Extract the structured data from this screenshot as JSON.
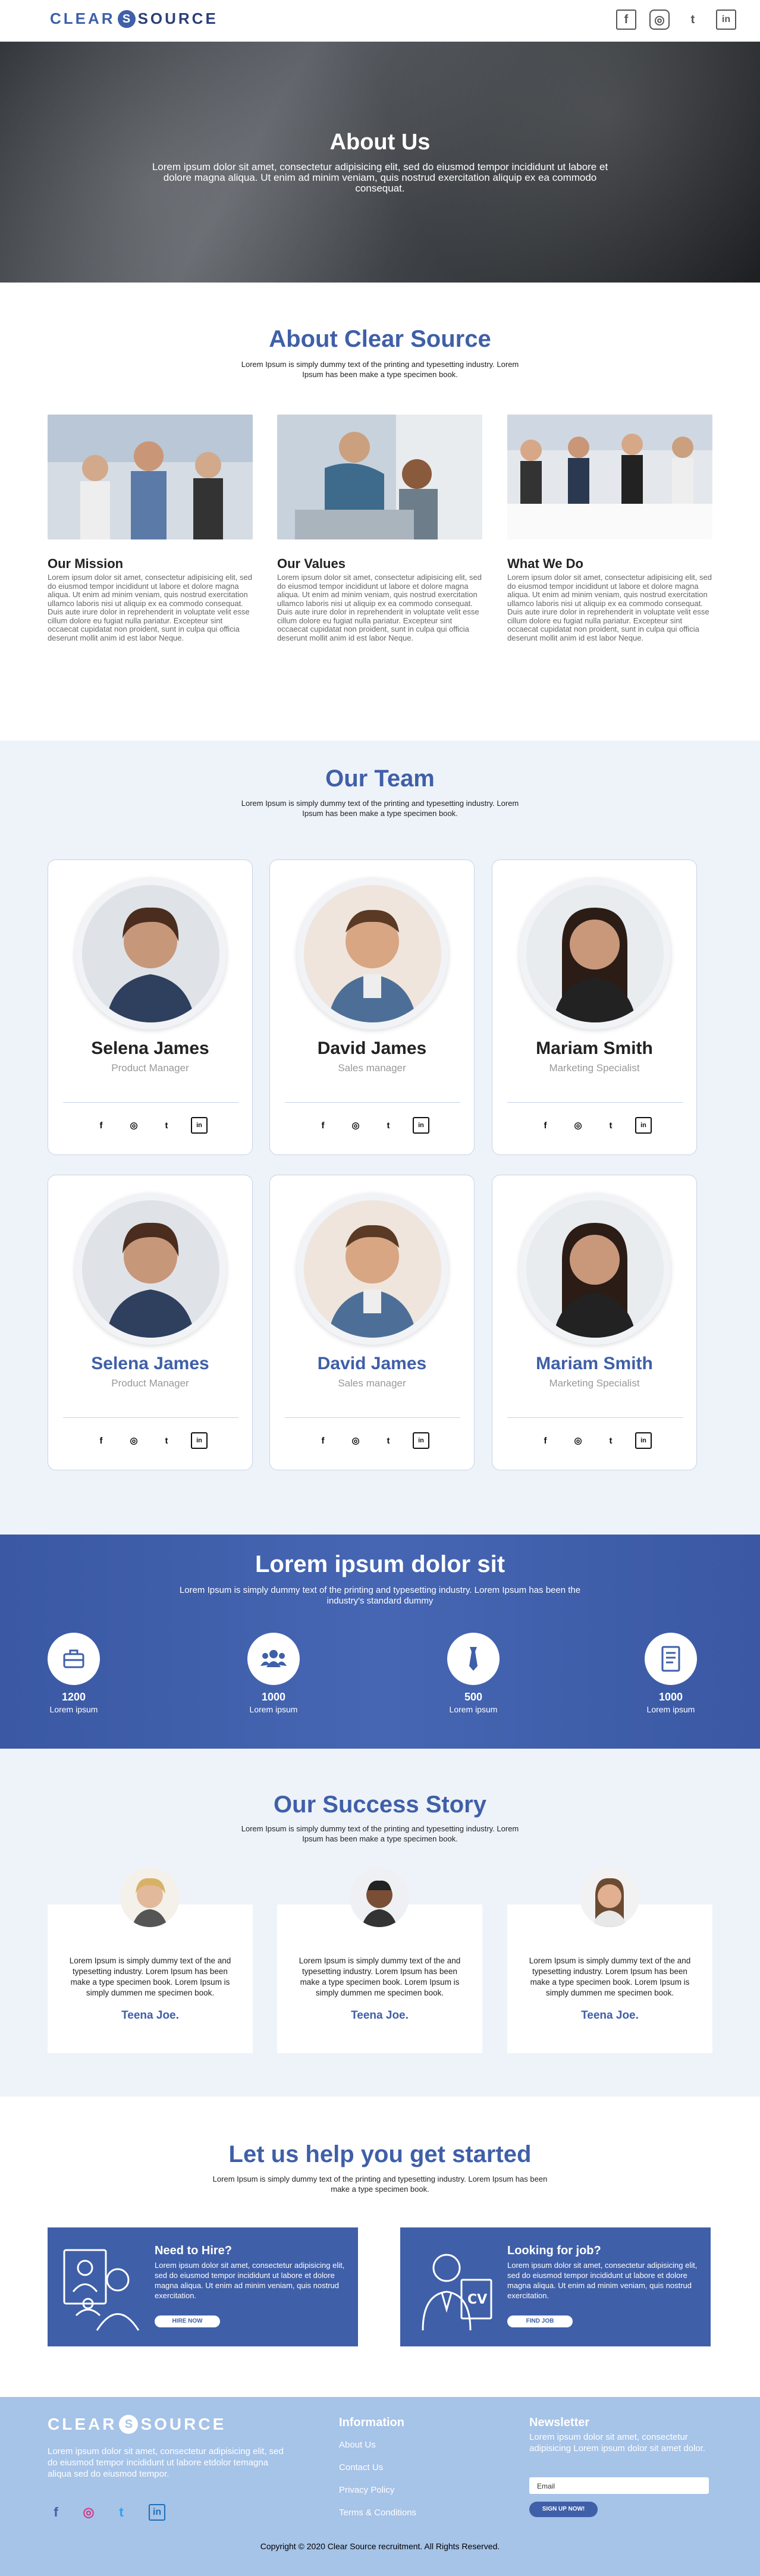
{
  "brand": {
    "logo_left": "CLEAR",
    "logo_right": "SOURCE",
    "logo_s": "S",
    "color": "#3f5fa8"
  },
  "header": {
    "social": [
      "f",
      "◎",
      "t",
      "in"
    ]
  },
  "hero": {
    "title": "About Us",
    "text": "Lorem ipsum dolor sit amet, consectetur adipisicing elit, sed do eiusmod tempor incididunt ut labore et dolore magna aliqua. Ut enim ad minim veniam, quis nostrud exercitation aliquip ex ea commodo consequat."
  },
  "about": {
    "title": "About Clear Source",
    "subtitle": "Lorem Ipsum is simply dummy text of the printing and typesetting industry. Lorem Ipsum has been make a type specimen book.",
    "items": [
      {
        "heading": "Our Mission",
        "text": "Lorem ipsum dolor sit amet, consectetur adipisicing elit, sed do eiusmod tempor incididunt ut labore et dolore magna aliqua. Ut enim ad minim veniam, quis nostrud exercitation ullamco laboris nisi ut aliquip ex ea commodo consequat. Duis aute irure dolor in reprehenderit in voluptate velit esse cillum dolore eu fugiat nulla pariatur. Excepteur sint occaecat cupidatat non proident, sunt in culpa qui officia deserunt mollit anim id est labor Neque."
      },
      {
        "heading": "Our Values",
        "text": "Lorem ipsum dolor sit amet, consectetur adipisicing elit, sed do eiusmod tempor incididunt ut labore et dolore magna aliqua. Ut enim ad minim veniam, quis nostrud exercitation ullamco laboris nisi ut aliquip ex ea commodo consequat. Duis aute irure dolor in reprehenderit in voluptate velit esse cillum dolore eu fugiat nulla pariatur. Excepteur sint occaecat cupidatat non proident, sunt in culpa qui officia deserunt mollit anim id est labor Neque."
      },
      {
        "heading": "What We Do",
        "text": "Lorem ipsum dolor sit amet, consectetur adipisicing elit, sed do eiusmod tempor incididunt ut labore et dolore magna aliqua. Ut enim ad minim veniam, quis nostrud exercitation ullamco laboris nisi ut aliquip ex ea commodo consequat. Duis aute irure dolor in reprehenderit in voluptate velit esse cillum dolore eu fugiat nulla pariatur. Excepteur sint occaecat cupidatat non proident, sunt in culpa qui officia deserunt mollit anim id est labor Neque."
      }
    ]
  },
  "team": {
    "title": "Our Team",
    "subtitle": "Lorem Ipsum is simply dummy text of the printing and typesetting industry. Lorem Ipsum has been make a type specimen book.",
    "members": [
      {
        "name": "Selena James",
        "role": "Product Manager"
      },
      {
        "name": "David James",
        "role": "Sales manager"
      },
      {
        "name": "Mariam Smith",
        "role": "Marketing Specialist"
      },
      {
        "name": "Selena James",
        "role": "Product Manager"
      },
      {
        "name": "David James",
        "role": "Sales manager"
      },
      {
        "name": "Mariam Smith",
        "role": "Marketing Specialist"
      }
    ],
    "social": [
      "f",
      "◎",
      "t",
      "in"
    ]
  },
  "stats": {
    "title": "Lorem ipsum dolor sit",
    "text": "Lorem Ipsum is simply dummy text of the printing and typesetting industry. Lorem Ipsum has been the industry's standard dummy",
    "items": [
      {
        "number": "1200",
        "label": "Lorem ipsum",
        "icon": "briefcase-icon"
      },
      {
        "number": "1000",
        "label": "Lorem ipsum",
        "icon": "users-icon"
      },
      {
        "number": "500",
        "label": "Lorem ipsum",
        "icon": "tie-icon"
      },
      {
        "number": "1000",
        "label": "Lorem ipsum",
        "icon": "document-icon"
      }
    ]
  },
  "success": {
    "title": "Our Success Story",
    "subtitle": "Lorem Ipsum is simply dummy text of the printing and typesetting industry. Lorem Ipsum has been make a type specimen book.",
    "stories": [
      {
        "text": "Lorem Ipsum is simply dummy text of the and typesetting industry. Lorem Ipsum has been make a type specimen book. Lorem Ipsum is simply dummen me specimen book.",
        "author": "Teena Joe."
      },
      {
        "text": "Lorem Ipsum is simply dummy text of the and typesetting industry. Lorem Ipsum has been make a type specimen book. Lorem Ipsum is simply dummen me specimen book.",
        "author": "Teena Joe."
      },
      {
        "text": "Lorem Ipsum is simply dummy text of the and typesetting industry. Lorem Ipsum has been make a type specimen book. Lorem Ipsum is simply dummen me specimen book.",
        "author": "Teena Joe."
      }
    ]
  },
  "help": {
    "title": "Let us help you get started",
    "subtitle": "Lorem Ipsum is simply dummy text of the printing and typesetting industry. Lorem Ipsum has been make a type specimen book.",
    "cards": [
      {
        "heading": "Need to Hire?",
        "text": "Lorem ipsum dolor sit amet, consectetur adipisicing elit, sed do eiusmod tempor incididunt ut labore et dolore magna aliqua. Ut enim ad minim veniam, quis nostrud exercitation.",
        "button": "HIRE NOW"
      },
      {
        "heading": "Looking for job?",
        "text": "Lorem ipsum dolor sit amet, consectetur adipisicing elit, sed do eiusmod tempor incididunt ut labore et dolore magna aliqua. Ut enim ad minim veniam, quis nostrud exercitation.",
        "button": "FIND JOB"
      }
    ]
  },
  "footer": {
    "text": "Lorem ipsum dolor sit amet, consectetur adipisicing elit, sed do eiusmod tempor incididunt ut labore etdolor temagna aliqua sed do eiusmod tempor.",
    "info_title": "Information",
    "links": [
      "About Us",
      "Contact Us",
      "Privacy Policy",
      "Terms & Conditions"
    ],
    "newsletter_title": "Newsletter",
    "newsletter_text": "Lorem ipsum dolor sit amet, consectetur adipisicing Lorem ipsum dolor sit amet dolor.",
    "email_placeholder": "Email",
    "signup": "SIGN UP NOW!",
    "copyright": "Copyright © 2020 Clear Source recruitment. All Rights Reserved."
  }
}
